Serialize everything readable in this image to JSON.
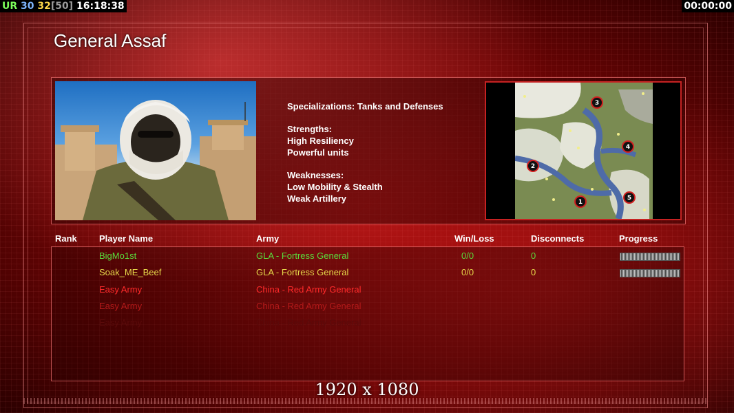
{
  "hud": {
    "ur": "UR",
    "fps": "30",
    "current": "32",
    "cap": "[50]",
    "clock": "16:18:38",
    "timer": "00:00:00"
  },
  "general": {
    "name": "General Assaf",
    "specializations": "Specializations: Tanks and Defenses",
    "strengths_title": "Strengths:",
    "strengths": [
      "High Resiliency",
      "Powerful units"
    ],
    "weaknesses_title": "Weaknesses:",
    "weaknesses": [
      "Low Mobility & Stealth",
      "Weak Artillery"
    ]
  },
  "map": {
    "start_positions": [
      "1",
      "2",
      "3",
      "4",
      "5"
    ]
  },
  "table": {
    "headers": {
      "rank": "Rank",
      "player": "Player Name",
      "army": "Army",
      "winloss": "Win/Loss",
      "disconnects": "Disconnects",
      "progress": "Progress"
    },
    "rows": [
      {
        "player": "BigMo1st",
        "army": "GLA - Fortress General",
        "winloss": "0/0",
        "disconnects": "0",
        "color": "#5adc3c",
        "progress": 1.0
      },
      {
        "player": "Soak_ME_Beef",
        "army": "GLA - Fortress General",
        "winloss": "0/0",
        "disconnects": "0",
        "color": "#e6d84a",
        "progress": 1.0
      },
      {
        "player": "Easy Army",
        "army": "China - Red Army General",
        "color": "#ff2a2a"
      },
      {
        "player": "Easy Army",
        "army": "China - Red Army General",
        "color": "#b41a1a"
      },
      {
        "player": "Easy Army",
        "army": "China - Red Army General",
        "color": "#5a0a0a"
      }
    ]
  },
  "resolution": "1920 x 1080"
}
